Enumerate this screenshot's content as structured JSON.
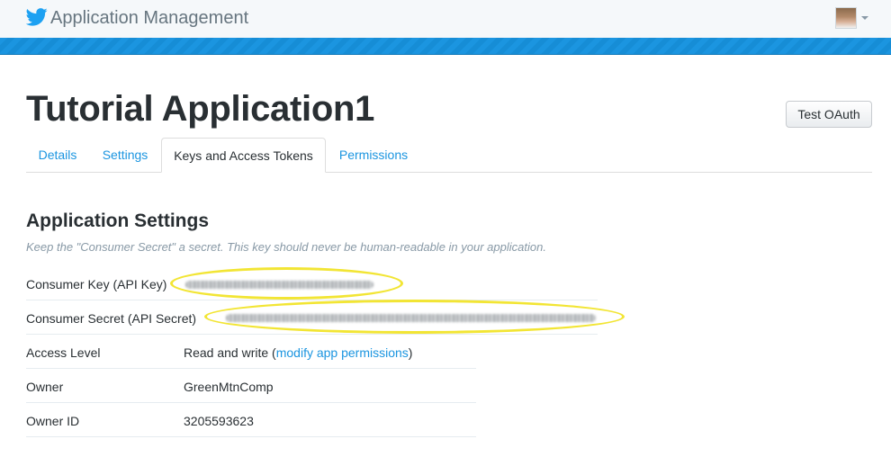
{
  "header": {
    "brand": "Application Management",
    "logo_icon": "twitter-bird-icon",
    "avatar_icon": "user-avatar",
    "menu_icon": "caret-down-icon"
  },
  "app": {
    "title": "Tutorial Application1",
    "test_oauth_label": "Test OAuth"
  },
  "tabs": [
    {
      "label": "Details",
      "active": false
    },
    {
      "label": "Settings",
      "active": false
    },
    {
      "label": "Keys and Access Tokens",
      "active": true
    },
    {
      "label": "Permissions",
      "active": false
    }
  ],
  "settings": {
    "title": "Application Settings",
    "note": "Keep the \"Consumer Secret\" a secret. This key should never be human-readable in your application.",
    "rows": [
      {
        "label": "Consumer Key (API Key)",
        "value": "",
        "redacted": true
      },
      {
        "label": "Consumer Secret (API Secret)",
        "value": "",
        "redacted": true
      },
      {
        "label": "Access Level",
        "value": "Read and write (",
        "link": "modify app permissions",
        "suffix": ")"
      },
      {
        "label": "Owner",
        "value": "GreenMtnComp"
      },
      {
        "label": "Owner ID",
        "value": "3205593623"
      }
    ]
  },
  "colors": {
    "accent": "#1b95e0",
    "highlight": "#f2e534",
    "text": "#292f33",
    "muted": "#8899a6"
  }
}
